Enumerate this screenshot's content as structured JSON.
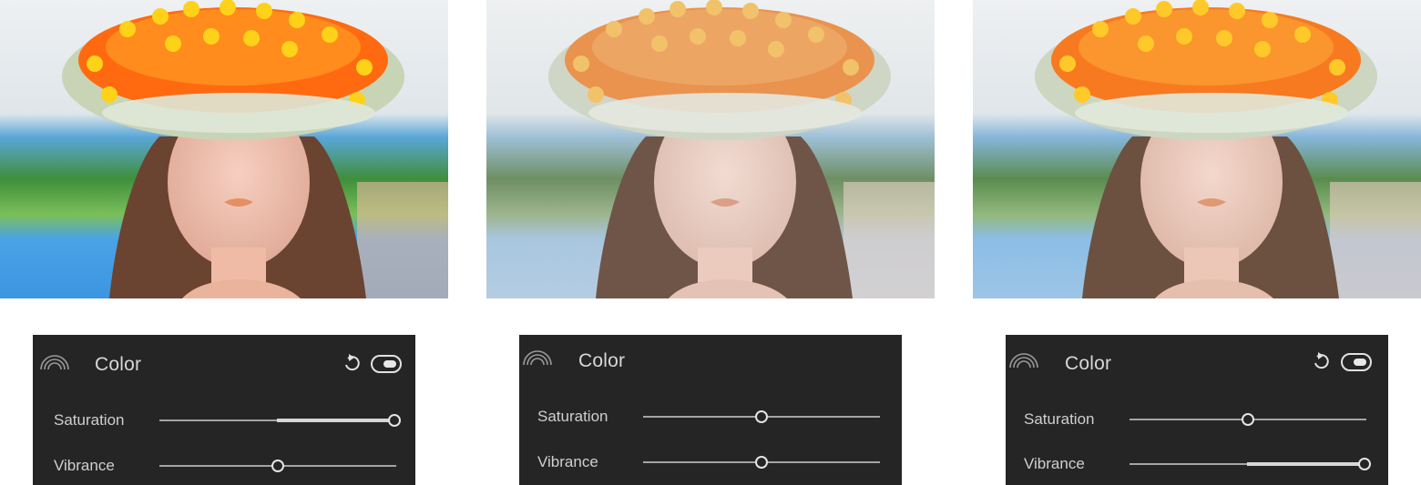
{
  "panels": [
    {
      "title": "Color",
      "has_controls": true,
      "sliders": [
        {
          "label": "Saturation",
          "value": 1.0,
          "origin": 0.5
        },
        {
          "label": "Vibrance",
          "value": 0.5,
          "origin": 0.5
        }
      ]
    },
    {
      "title": "Color",
      "has_controls": false,
      "sliders": [
        {
          "label": "Saturation",
          "value": 0.5,
          "origin": 0.5
        },
        {
          "label": "Vibrance",
          "value": 0.5,
          "origin": 0.5
        }
      ]
    },
    {
      "title": "Color",
      "has_controls": true,
      "sliders": [
        {
          "label": "Saturation",
          "value": 0.5,
          "origin": 0.5
        },
        {
          "label": "Vibrance",
          "value": 1.0,
          "origin": 0.5
        }
      ]
    }
  ],
  "icons": {
    "section": "rainbow-icon",
    "reset": "reset-arrow-icon",
    "toggle": "enable-toggle"
  },
  "photo_variants": [
    "saturation-boosted",
    "original",
    "vibrance-boosted"
  ]
}
